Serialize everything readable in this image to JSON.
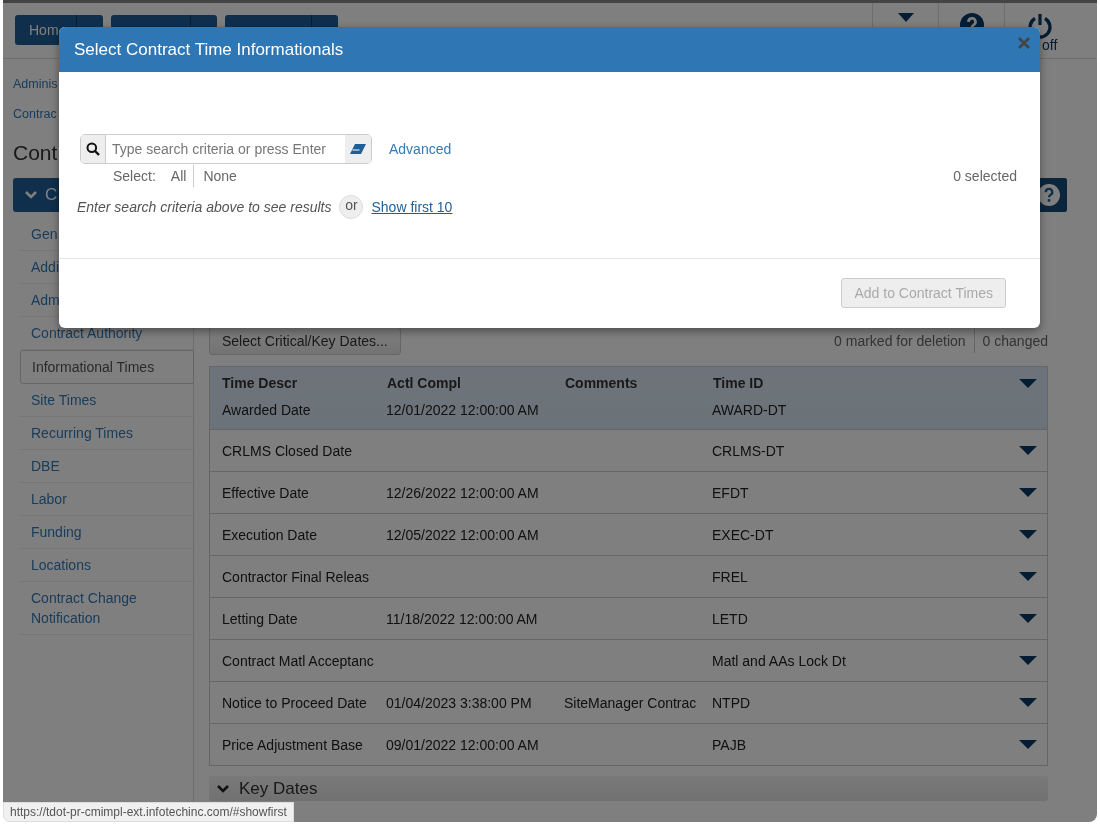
{
  "top_nav": {
    "home_button": "Hom",
    "logoff_label": "off"
  },
  "breadcrumbs": [
    "Adminis",
    "Contrac"
  ],
  "page_title": "Cont",
  "section": {
    "title": "C",
    "expanded": true
  },
  "sidebar": {
    "items": [
      {
        "label": "Gen",
        "selected": false
      },
      {
        "label": "Addi",
        "selected": false
      },
      {
        "label": "Adm",
        "selected": false
      },
      {
        "label": "Contract Authority",
        "selected": false
      },
      {
        "label": "Informational Times",
        "selected": true
      },
      {
        "label": "Site Times",
        "selected": false
      },
      {
        "label": "Recurring Times",
        "selected": false
      },
      {
        "label": "DBE",
        "selected": false
      },
      {
        "label": "Labor",
        "selected": false
      },
      {
        "label": "Funding",
        "selected": false
      },
      {
        "label": "Locations",
        "selected": false
      },
      {
        "label": "Contract Change Notification",
        "selected": false
      }
    ]
  },
  "main": {
    "select_button": "Select Critical/Key Dates...",
    "marked_for_deletion": "0 marked for deletion",
    "changed": "0 changed"
  },
  "table": {
    "columns": [
      "Time Descr",
      "Actl Compl",
      "Comments",
      "Time ID"
    ],
    "rows": [
      {
        "time_descr": "Awarded Date",
        "actl_compl": "12/01/2022 12:00:00 AM",
        "comments": "",
        "time_id": "AWARD-DT",
        "selected": true
      },
      {
        "time_descr": "CRLMS Closed Date",
        "actl_compl": "",
        "comments": "",
        "time_id": "CRLMS-DT",
        "selected": false
      },
      {
        "time_descr": "Effective Date",
        "actl_compl": "12/26/2022 12:00:00 AM",
        "comments": "",
        "time_id": "EFDT",
        "selected": false
      },
      {
        "time_descr": "Execution Date",
        "actl_compl": "12/05/2022 12:00:00 AM",
        "comments": "",
        "time_id": "EXEC-DT",
        "selected": false
      },
      {
        "time_descr": "Contractor Final Releas",
        "actl_compl": "",
        "comments": "",
        "time_id": "FREL",
        "selected": false
      },
      {
        "time_descr": "Letting Date",
        "actl_compl": "11/18/2022 12:00:00 AM",
        "comments": "",
        "time_id": "LETD",
        "selected": false
      },
      {
        "time_descr": "Contract Matl Acceptanc",
        "actl_compl": "",
        "comments": "",
        "time_id": "Matl and AAs Lock Dt",
        "selected": false
      },
      {
        "time_descr": "Notice to Proceed Date",
        "actl_compl": "01/04/2023 3:38:00 PM",
        "comments": "SiteManager Contrac",
        "time_id": "NTPD",
        "selected": false
      },
      {
        "time_descr": "Price Adjustment Base",
        "actl_compl": "09/01/2022 12:00:00 AM",
        "comments": "",
        "time_id": "PAJB",
        "selected": false
      }
    ]
  },
  "key_dates": {
    "title": "Key Dates",
    "expanded": false
  },
  "status_url": "https://tdot-pr-cmimpl-ext.infotechinc.com/#showfirst",
  "modal": {
    "title": "Select Contract Time Informationals",
    "search": {
      "placeholder": "Type search criteria or press Enter"
    },
    "advanced_link": "Advanced",
    "select_label": "Select:",
    "select_all": "All",
    "select_none": "None",
    "selected_count": "0 selected",
    "hint": "Enter search criteria above to see results",
    "or_label": "or",
    "show_first_link": "Show first 10",
    "add_button": {
      "label": "Add to Contract Times",
      "disabled": true
    }
  }
}
